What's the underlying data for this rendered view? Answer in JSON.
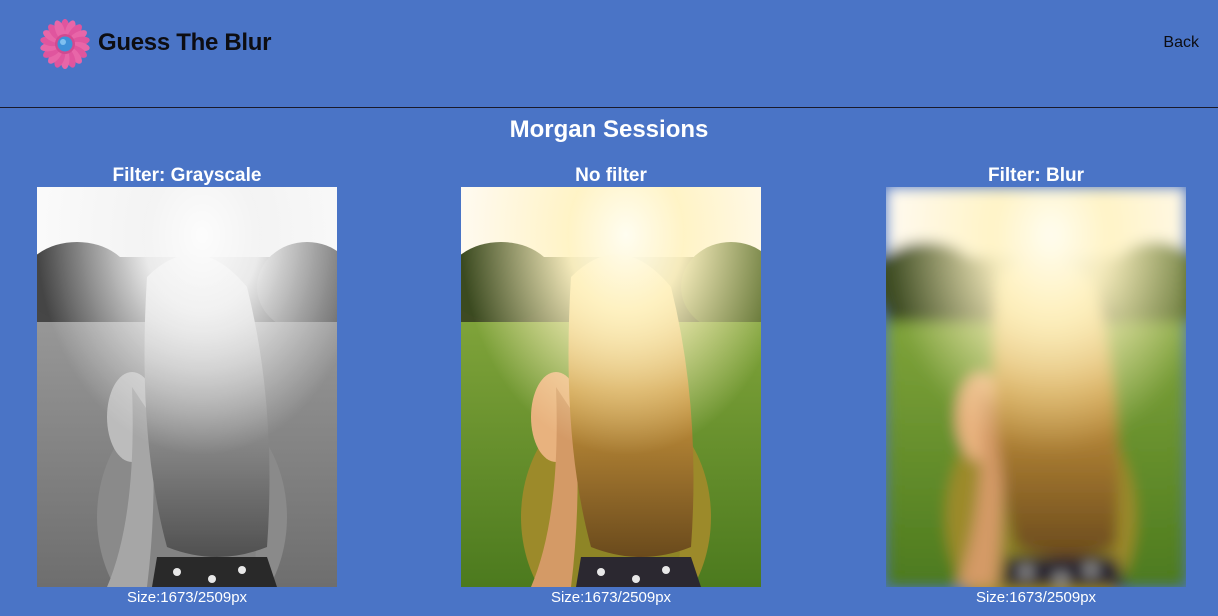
{
  "header": {
    "app_title": "Guess The Blur",
    "back_label": "Back",
    "logo_icon": "blur-flower-logo-icon"
  },
  "main": {
    "title": "Morgan Sessions",
    "panels": [
      {
        "label": "Filter: Grayscale",
        "size": "Size:1673/2509px",
        "filter": "grayscale"
      },
      {
        "label": "No filter",
        "size": "Size:1673/2509px",
        "filter": "none"
      },
      {
        "label": "Filter: Blur",
        "size": "Size:1673/2509px",
        "filter": "blur"
      }
    ]
  },
  "colors": {
    "background": "#4a74c6",
    "header_border": "#1a1a2a",
    "logo_petal": "#e0559e",
    "logo_center": "#3f90d8"
  }
}
